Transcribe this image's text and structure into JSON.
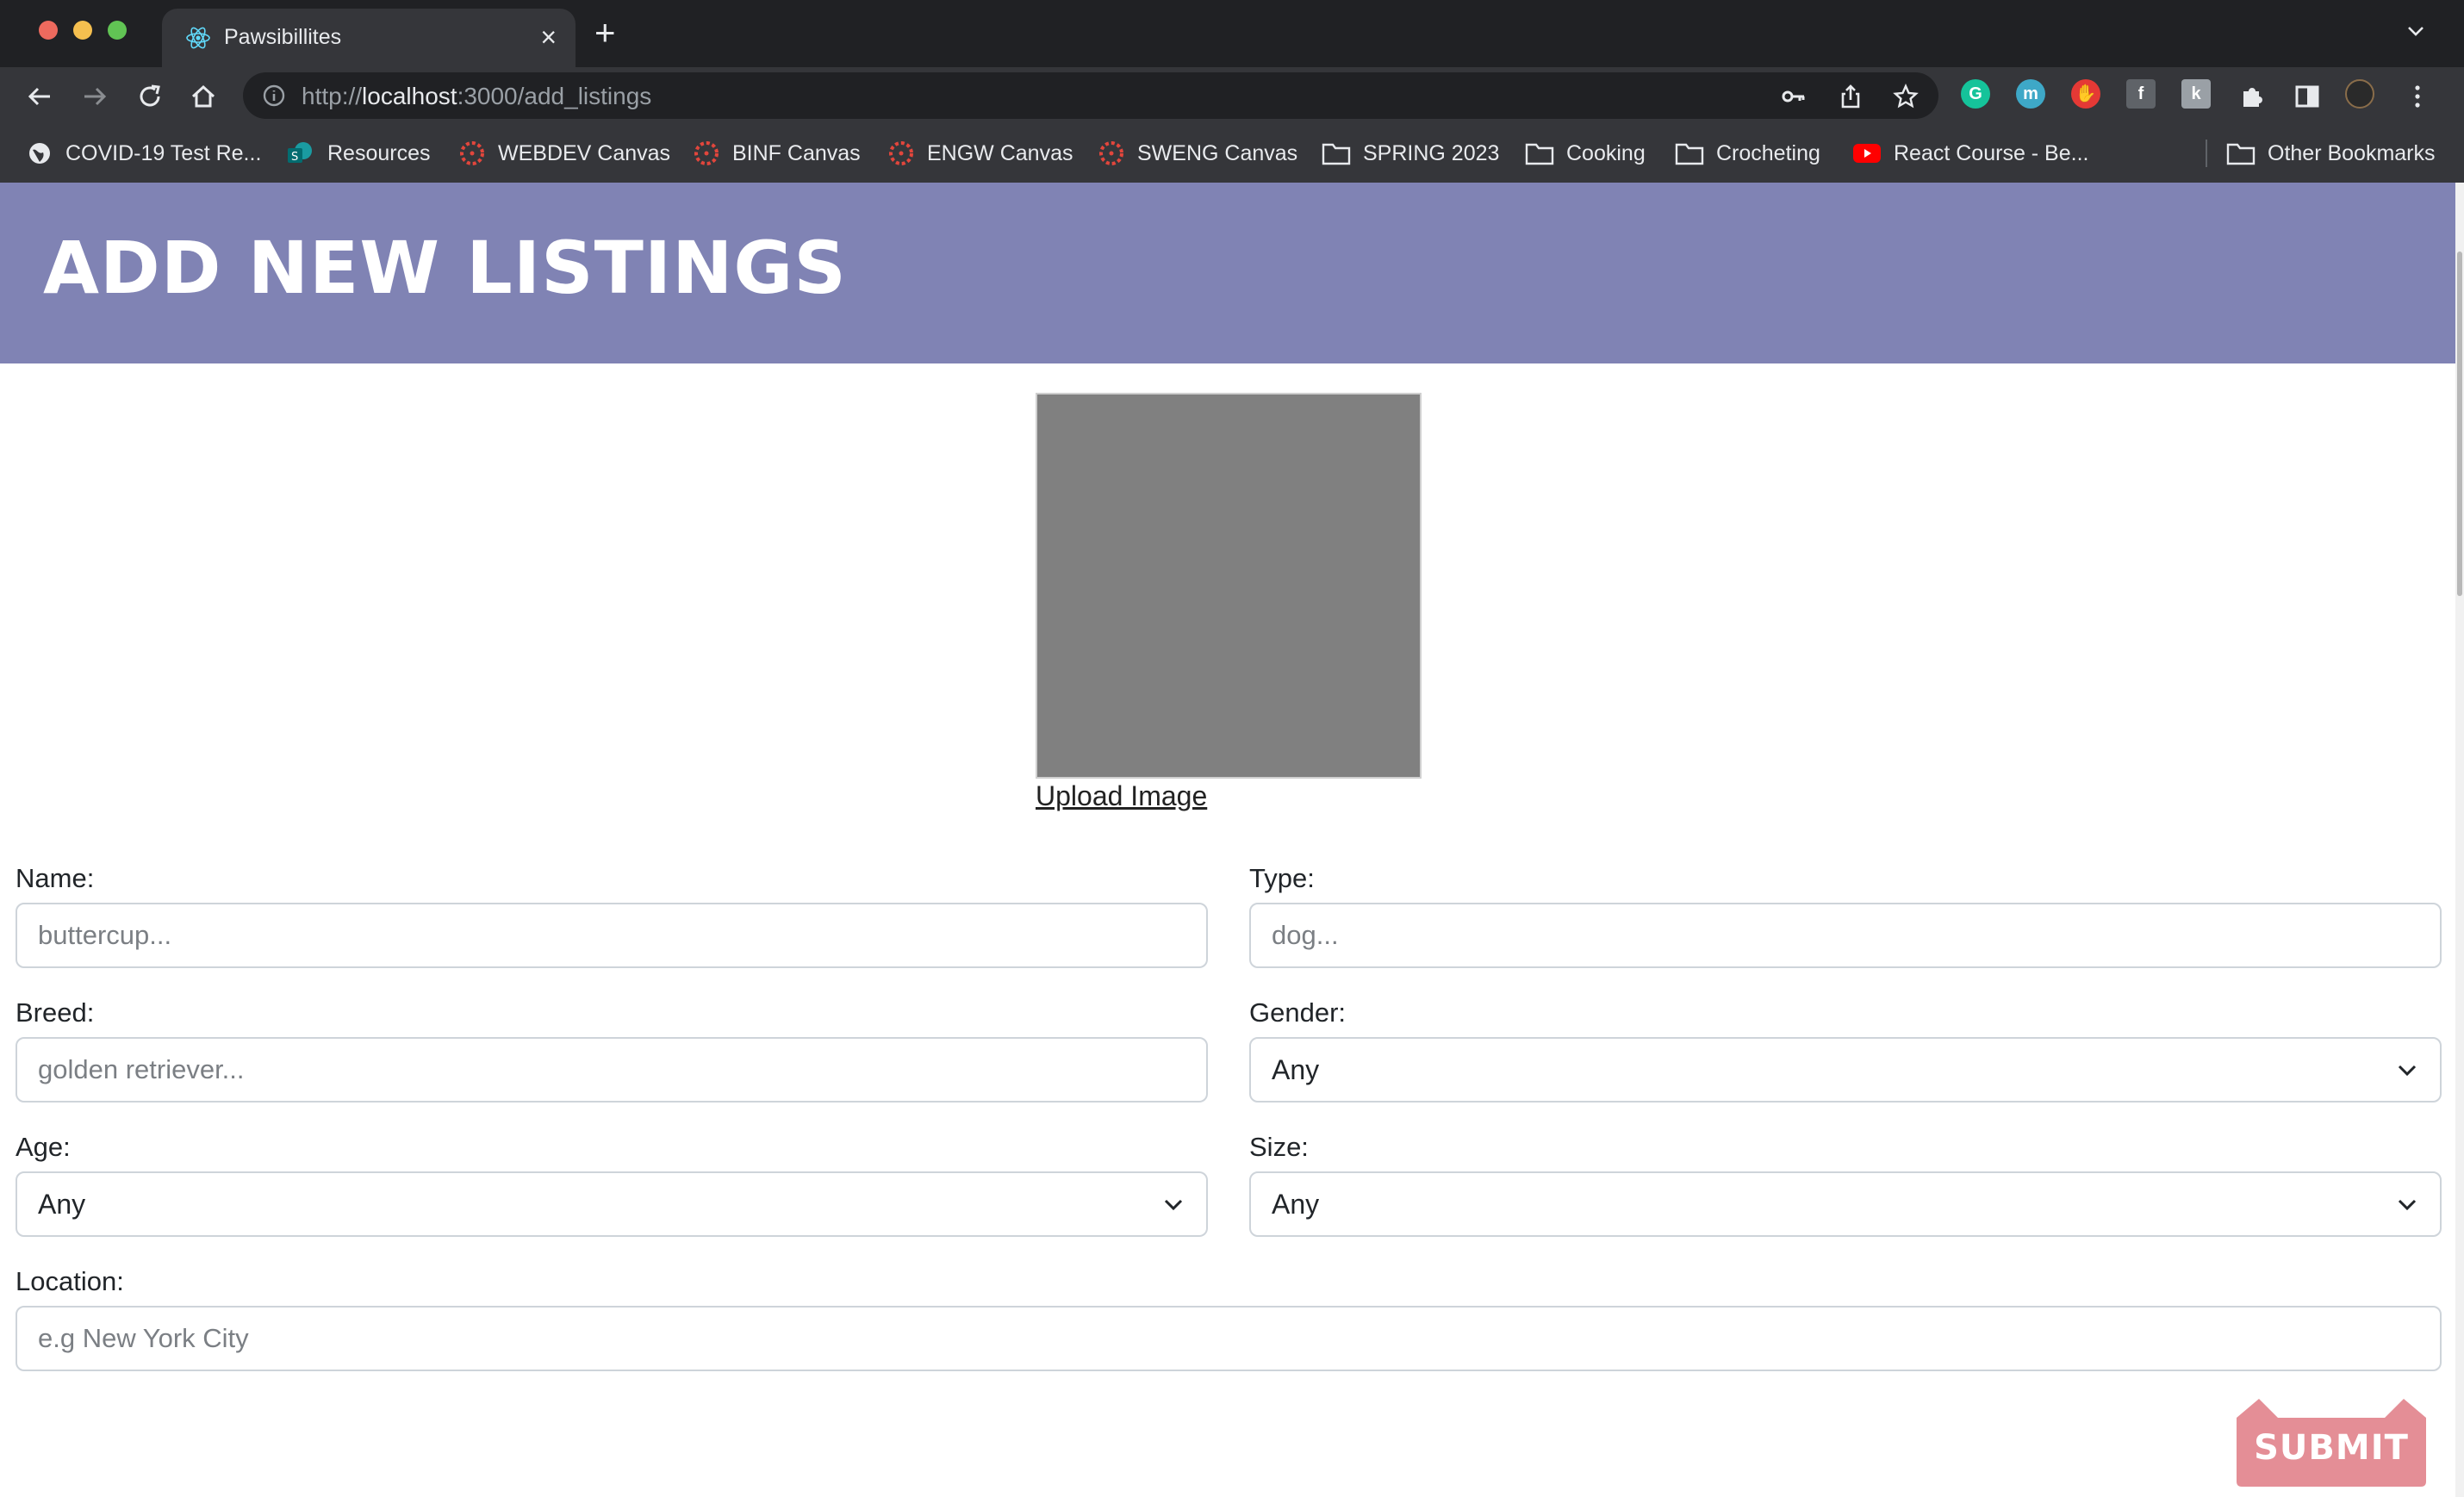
{
  "browser": {
    "tab_title": "Pawsibillites",
    "url_scheme": "http://",
    "url_host": "localhost",
    "url_rest": ":3000/add_listings",
    "bookmarks": [
      {
        "label": "COVID-19 Test Re...",
        "icon": "globe-icon"
      },
      {
        "label": "Resources",
        "icon": "sharepoint-icon"
      },
      {
        "label": "WEBDEV Canvas",
        "icon": "canvas-icon"
      },
      {
        "label": "BINF Canvas",
        "icon": "canvas-icon"
      },
      {
        "label": "ENGW Canvas",
        "icon": "canvas-icon"
      },
      {
        "label": "SWENG Canvas",
        "icon": "canvas-icon"
      },
      {
        "label": "SPRING 2023",
        "icon": "folder-icon"
      },
      {
        "label": "Cooking",
        "icon": "folder-icon"
      },
      {
        "label": "Crocheting",
        "icon": "folder-icon"
      },
      {
        "label": "React Course - Be...",
        "icon": "youtube-icon"
      },
      {
        "label": "Other Bookmarks",
        "icon": "folder-icon"
      }
    ]
  },
  "page": {
    "title": "ADD NEW LISTINGS",
    "upload_label": "Upload Image",
    "form": {
      "name": {
        "label": "Name:",
        "placeholder": "buttercup..."
      },
      "type": {
        "label": "Type:",
        "placeholder": "dog..."
      },
      "breed": {
        "label": "Breed:",
        "placeholder": "golden retriever..."
      },
      "gender": {
        "label": "Gender:",
        "value": "Any"
      },
      "age": {
        "label": "Age:",
        "value": "Any"
      },
      "size": {
        "label": "Size:",
        "value": "Any"
      },
      "location": {
        "label": "Location:",
        "placeholder": "e.g New York City"
      }
    },
    "submit_label": "SUBMIT"
  },
  "colors": {
    "header_bg": "#8083b4",
    "submit_bg": "#e48e96",
    "image_placeholder": "#808080"
  }
}
